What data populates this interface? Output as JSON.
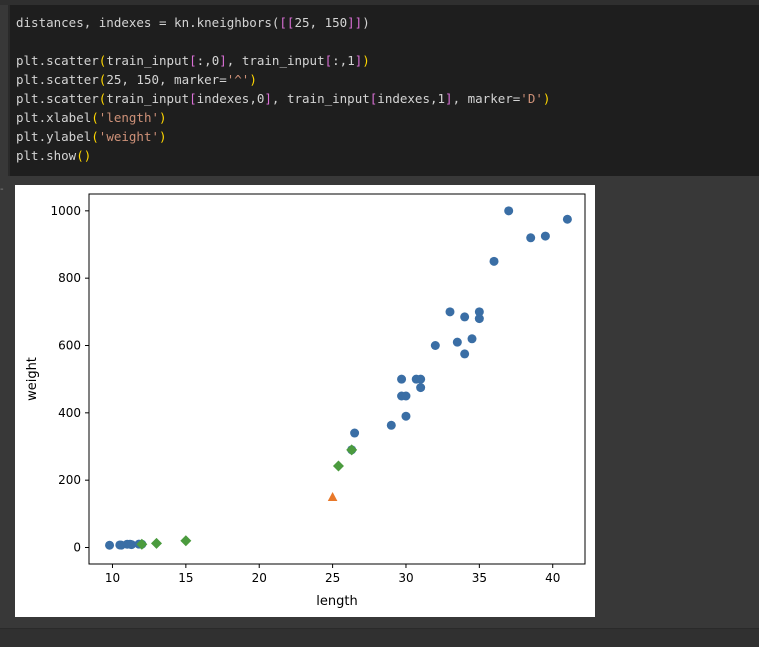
{
  "code_lines": [
    [
      {
        "t": "distances, indexes = kn.kneighbors("
      },
      {
        "t": "[[",
        "c": "tok-b2"
      },
      {
        "t": "25, 150"
      },
      {
        "t": "]]",
        "c": "tok-b2"
      },
      {
        "t": ")"
      }
    ],
    [],
    [
      {
        "t": "plt.scatter"
      },
      {
        "t": "(",
        "c": "tok-b1"
      },
      {
        "t": "train_input"
      },
      {
        "t": "[",
        "c": "tok-b2"
      },
      {
        "t": ":,0"
      },
      {
        "t": "]",
        "c": "tok-b2"
      },
      {
        "t": ", train_input"
      },
      {
        "t": "[",
        "c": "tok-b2"
      },
      {
        "t": ":,1"
      },
      {
        "t": "]",
        "c": "tok-b2"
      },
      {
        "t": ")",
        "c": "tok-b1"
      }
    ],
    [
      {
        "t": "plt.scatter"
      },
      {
        "t": "(",
        "c": "tok-b1"
      },
      {
        "t": "25, 150, marker="
      },
      {
        "t": "'^'",
        "c": "tok-str"
      },
      {
        "t": ")",
        "c": "tok-b1"
      }
    ],
    [
      {
        "t": "plt.scatter"
      },
      {
        "t": "(",
        "c": "tok-b1"
      },
      {
        "t": "train_input"
      },
      {
        "t": "[",
        "c": "tok-b2"
      },
      {
        "t": "indexes,0"
      },
      {
        "t": "]",
        "c": "tok-b2"
      },
      {
        "t": ", train_input"
      },
      {
        "t": "[",
        "c": "tok-b2"
      },
      {
        "t": "indexes,1"
      },
      {
        "t": "]",
        "c": "tok-b2"
      },
      {
        "t": ", marker="
      },
      {
        "t": "'D'",
        "c": "tok-str"
      },
      {
        "t": ")",
        "c": "tok-b1"
      }
    ],
    [
      {
        "t": "plt.xlabel"
      },
      {
        "t": "(",
        "c": "tok-b1"
      },
      {
        "t": "'length'",
        "c": "tok-str"
      },
      {
        "t": ")",
        "c": "tok-b1"
      }
    ],
    [
      {
        "t": "plt.ylabel"
      },
      {
        "t": "(",
        "c": "tok-b1"
      },
      {
        "t": "'weight'",
        "c": "tok-str"
      },
      {
        "t": ")",
        "c": "tok-b1"
      }
    ],
    [
      {
        "t": "plt.show"
      },
      {
        "t": "(",
        "c": "tok-b1"
      },
      {
        "t": ")",
        "c": "tok-b1"
      }
    ]
  ],
  "cell_marker": "-",
  "chart_data": {
    "type": "scatter",
    "xlabel": "length",
    "ylabel": "weight",
    "xlim": [
      8.4,
      42.2
    ],
    "ylim": [
      -49,
      1050
    ],
    "xticks": [
      10,
      15,
      20,
      25,
      30,
      35,
      40
    ],
    "yticks": [
      0,
      200,
      400,
      600,
      800,
      1000
    ],
    "grid": false,
    "series": [
      {
        "marker": "circle",
        "color": "#3a6ea5",
        "points": [
          [
            9.8,
            6.7
          ],
          [
            10.5,
            7.5
          ],
          [
            10.6,
            7.0
          ],
          [
            11.0,
            9.7
          ],
          [
            11.2,
            9.8
          ],
          [
            11.3,
            8.7
          ],
          [
            11.8,
            10.0
          ],
          [
            12.0,
            9.8
          ],
          [
            26.3,
            290
          ],
          [
            26.5,
            340
          ],
          [
            29.0,
            363
          ],
          [
            29.7,
            450
          ],
          [
            29.7,
            500
          ],
          [
            30.0,
            390
          ],
          [
            30.0,
            450
          ],
          [
            30.7,
            500
          ],
          [
            31.0,
            475
          ],
          [
            31.0,
            500
          ],
          [
            32.0,
            600
          ],
          [
            33.0,
            700
          ],
          [
            33.5,
            610
          ],
          [
            34.0,
            685
          ],
          [
            34.0,
            575
          ],
          [
            34.5,
            620
          ],
          [
            35.0,
            680
          ],
          [
            35.0,
            700
          ],
          [
            36.0,
            850
          ],
          [
            37.0,
            1000
          ],
          [
            38.5,
            920
          ],
          [
            39.5,
            925
          ],
          [
            41.0,
            975
          ]
        ]
      },
      {
        "marker": "triangle",
        "color": "#e8782a",
        "points": [
          [
            25,
            150
          ]
        ]
      },
      {
        "marker": "diamond",
        "color": "#4b9b3e",
        "points": [
          [
            25.4,
            242
          ],
          [
            26.3,
            290
          ],
          [
            12.0,
            9.8
          ],
          [
            13.0,
            12.2
          ],
          [
            15.0,
            19.9
          ]
        ]
      }
    ]
  }
}
